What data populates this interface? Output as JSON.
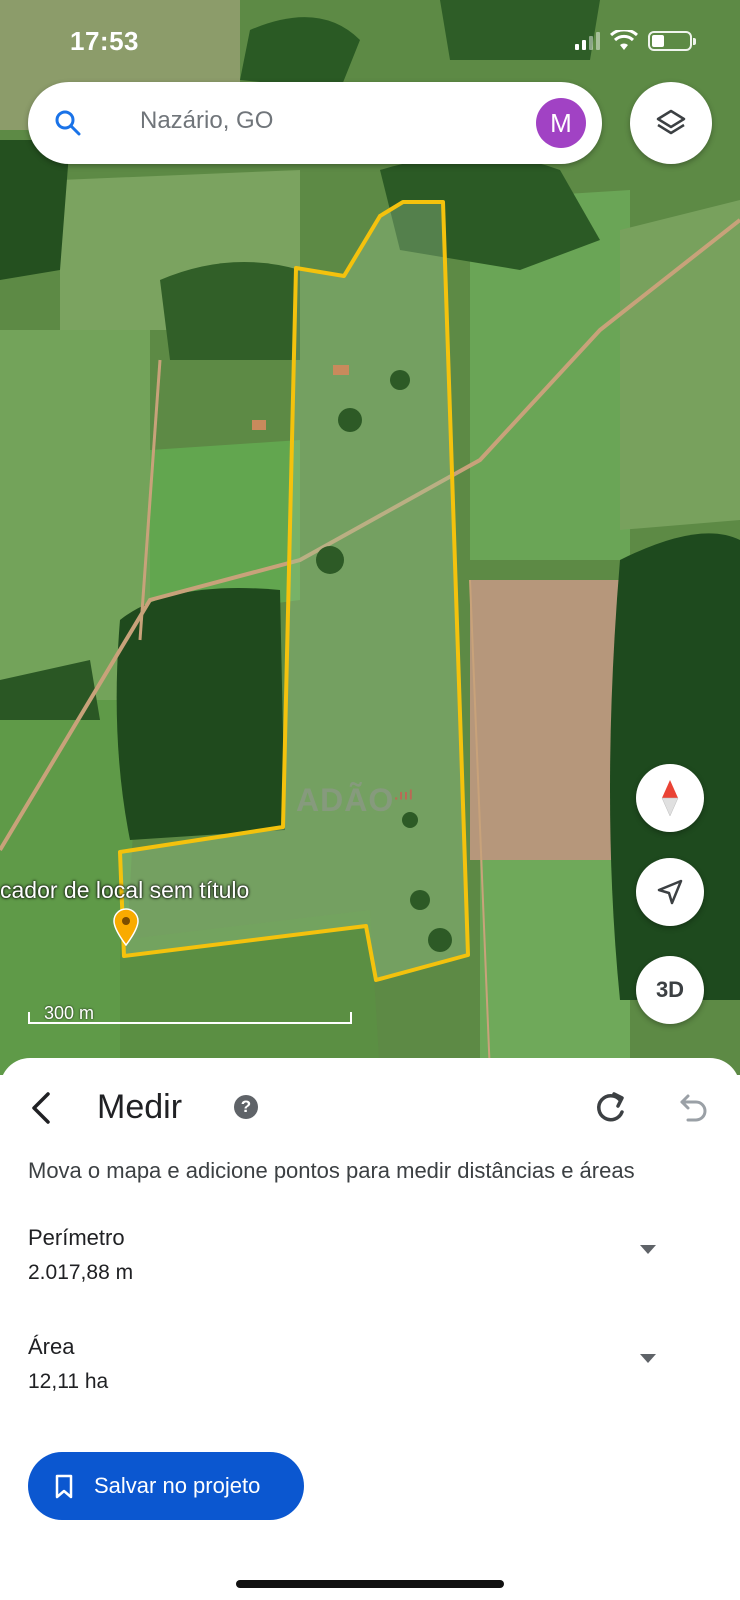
{
  "status_bar": {
    "time": "17:53"
  },
  "search": {
    "placeholder": "Nazário, GO",
    "avatar_letter": "M",
    "avatar_color": "#a142c4"
  },
  "map": {
    "watermark": "ADÃO",
    "pin_label": "cador de local sem título",
    "pin_color": "#f9ab00",
    "polygon_color": "#f4c20d",
    "scale_label": "300 m",
    "buttons": {
      "layers": "layers-icon",
      "compass": "compass-icon",
      "my_location": "navigation-arrow-icon",
      "three_d_label": "3D"
    }
  },
  "sheet": {
    "title": "Medir",
    "help": "?",
    "instructions": "Mova o mapa e adicione pontos para medir distâncias e áreas",
    "perimeter": {
      "label": "Perímetro",
      "value": "2.017,88 m"
    },
    "area": {
      "label": "Área",
      "value": "12,11 ha"
    },
    "save_button": "Salvar no projeto",
    "accent": "#0b57d0"
  }
}
